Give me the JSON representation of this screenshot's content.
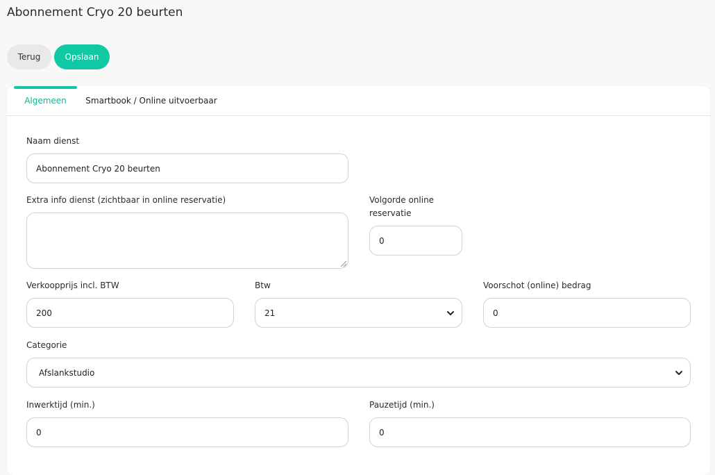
{
  "page": {
    "title": "Abonnement Cryo 20 beurten"
  },
  "actions": {
    "back_label": "Terug",
    "save_label": "Opslaan"
  },
  "tabs": [
    {
      "label": "Algemeen",
      "active": true
    },
    {
      "label": "Smartbook / Online uitvoerbaar",
      "active": false
    }
  ],
  "form": {
    "name": {
      "label": "Naam dienst",
      "value": "Abonnement Cryo 20 beurten"
    },
    "extra_info": {
      "label": "Extra info dienst (zichtbaar in online reservatie)",
      "value": ""
    },
    "order": {
      "label_line1": "Volgorde online",
      "label_line2": "reservatie",
      "value": "0"
    },
    "price": {
      "label": "Verkoopprijs incl. BTW",
      "value": "200"
    },
    "vat": {
      "label": "Btw",
      "value": "21",
      "icon": "chevron-down-icon"
    },
    "deposit": {
      "label": "Voorschot (online) bedrag",
      "value": "0"
    },
    "category": {
      "label": "Categorie",
      "value": "Afslankstudio",
      "icon": "chevron-down-icon"
    },
    "work_time": {
      "label": "Inwerktijd (min.)",
      "value": "0"
    },
    "pause_time": {
      "label": "Pauzetijd (min.)",
      "value": "0"
    }
  },
  "colors": {
    "accent": "#10c9a4",
    "accent_text": "#10b394",
    "border": "#d2d2d2"
  }
}
